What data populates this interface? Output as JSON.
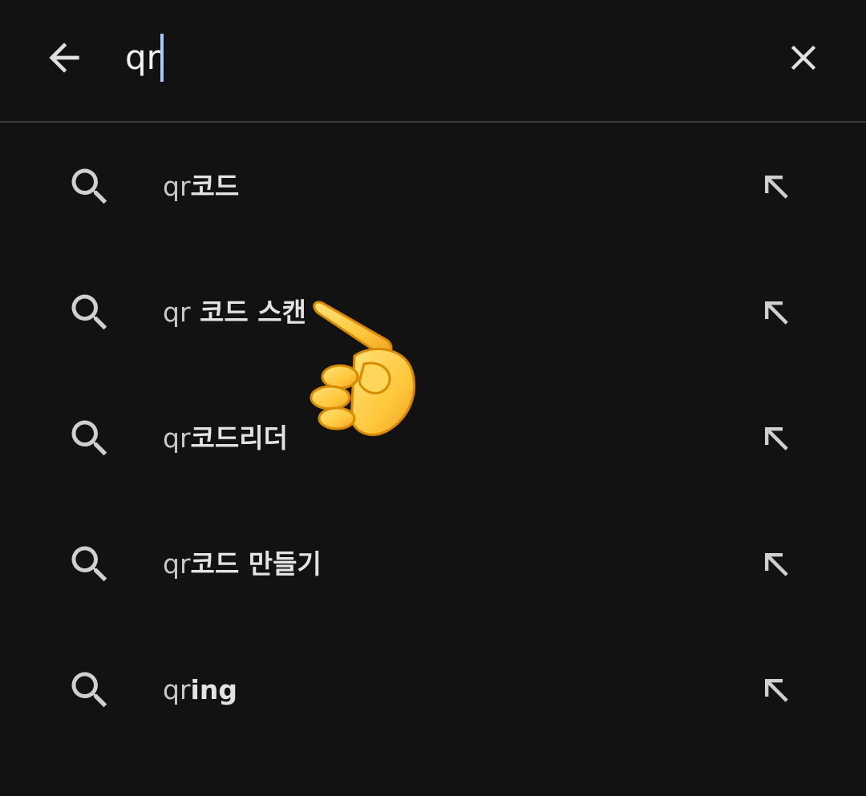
{
  "search": {
    "query": "qr",
    "back_icon": "arrow-left-icon",
    "clear_icon": "close-icon"
  },
  "suggestions": [
    {
      "prefix": "qr",
      "rest": "코드"
    },
    {
      "prefix": "qr",
      "rest": " 코드 스캔"
    },
    {
      "prefix": "qr",
      "rest": "코드리더"
    },
    {
      "prefix": "qr",
      "rest": "코드 만들기"
    },
    {
      "prefix": "qr",
      "rest": "ing"
    }
  ],
  "icons": {
    "suggestion": "search-icon",
    "fill": "arrow-up-left-icon",
    "overlay": "pointing-hand-emoji"
  },
  "colors": {
    "background": "#121212",
    "text": "#e3e3e3",
    "icon": "#cfcfcf",
    "caret": "#a8c7fa",
    "divider": "#3d3d3d"
  }
}
